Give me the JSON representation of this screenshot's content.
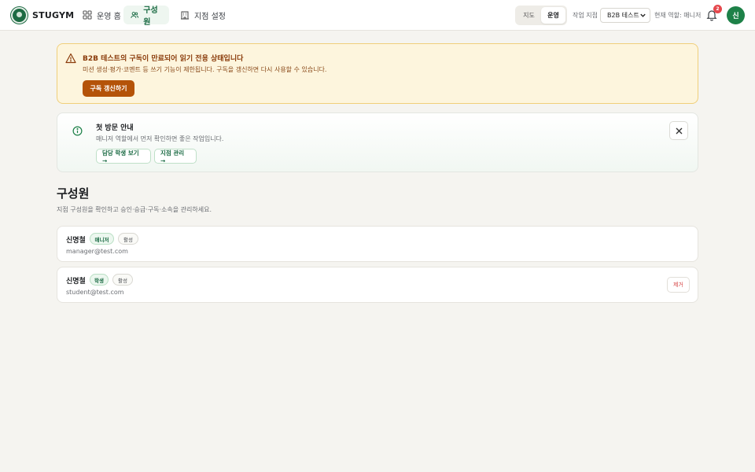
{
  "header": {
    "brand": "STUGYM",
    "nav": [
      {
        "label": "운영 홈",
        "icon": "grid-icon"
      },
      {
        "label": "구성원",
        "icon": "users-icon",
        "active": true
      },
      {
        "label": "지점 설정",
        "icon": "building-icon"
      }
    ],
    "mode_toggle": {
      "options": [
        "지도",
        "운영"
      ],
      "selected": "운영"
    },
    "branch_label": "작업 지점",
    "branch_select": "B2B 테스트",
    "role_text": "현재 역할: 매니저",
    "notification_count": "2",
    "avatar_initial": "신"
  },
  "warning": {
    "title": "B2B 테스트의 구독이 만료되어 읽기 전용 상태입니다",
    "description": "미션 생성·평가·코멘트 등 쓰기 기능이 제한됩니다. 구독을 갱신하면 다시 사용할 수 있습니다.",
    "button": "구독 갱신하기"
  },
  "info": {
    "title": "첫 방문 안내",
    "description": "매니저 역할에서 먼저 확인하면 좋은 작업입니다.",
    "actions": [
      "담당 학생 보기 →",
      "지점 관리 →"
    ]
  },
  "page": {
    "title": "구성원",
    "subtitle": "지점 구성원을 확인하고 승인·승급·구독·소속을 관리하세요."
  },
  "members": [
    {
      "name": "신명철",
      "role": "매니저",
      "status": "활성",
      "email": "manager@test.com",
      "removable": false
    },
    {
      "name": "신명철",
      "role": "학생",
      "status": "활성",
      "email": "student@test.com",
      "removable": true,
      "remove_label": "제거"
    }
  ],
  "colors": {
    "brand_green": "#1d6b43",
    "accent_green": "#1d8148",
    "warning_bg": "#fdf5dd",
    "warning_button": "#b45309",
    "danger": "#d64545"
  }
}
